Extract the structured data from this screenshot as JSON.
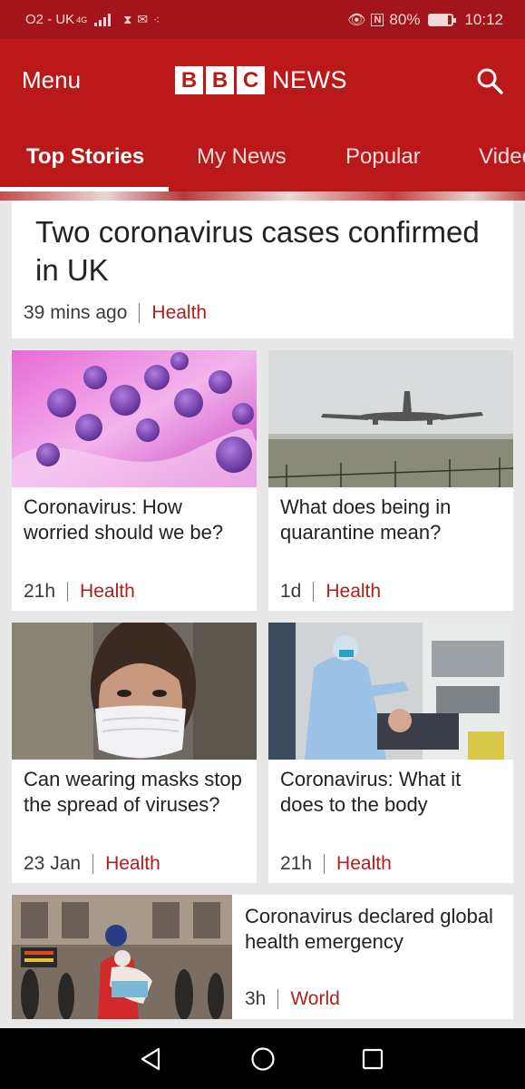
{
  "status": {
    "carrier": "O2 - UK",
    "network": "4G",
    "battery": "80%",
    "battery_level": 0.8,
    "time": "10:12"
  },
  "appbar": {
    "menu_label": "Menu",
    "logo_letters": [
      "B",
      "B",
      "C"
    ],
    "logo_word": "NEWS"
  },
  "tabs": [
    {
      "label": "Top Stories",
      "active": true
    },
    {
      "label": "My News",
      "active": false
    },
    {
      "label": "Popular",
      "active": false
    },
    {
      "label": "Video",
      "active": false
    }
  ],
  "stories": {
    "hero": {
      "title": "Two coronavirus cases confirmed in UK",
      "time": "39 mins ago",
      "section": "Health"
    },
    "s1": {
      "title": "Coronavirus: How worried should we be?",
      "time": "21h",
      "section": "Health"
    },
    "s2": {
      "title": "What does being in quarantine mean?",
      "time": "1d",
      "section": "Health"
    },
    "s3": {
      "title": "Can wearing masks stop the spread of viruses?",
      "time": "23 Jan",
      "section": "Health"
    },
    "s4": {
      "title": "Coronavirus: What it does to the body",
      "time": "21h",
      "section": "Health"
    },
    "s5": {
      "title": "Coronavirus declared global health emergency",
      "time": "3h",
      "section": "World"
    }
  },
  "colors": {
    "brand": "#bb1919",
    "status_bar": "#a3151a",
    "section": "#b01e1e"
  }
}
